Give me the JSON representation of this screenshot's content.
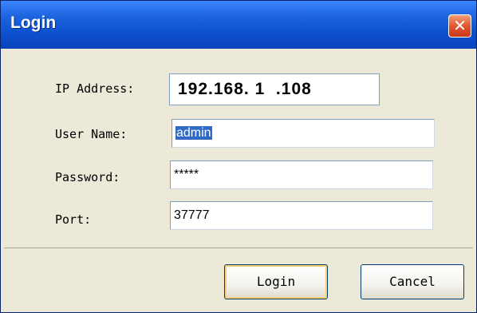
{
  "window": {
    "title": "Login",
    "close_symbol": "✕"
  },
  "form": {
    "ip_label": "IP Address:",
    "ip_value": "192.168. 1  .108",
    "user_label": "User Name:",
    "user_value": "admin",
    "password_label": "Password:",
    "password_value": "*****",
    "port_label": "Port:",
    "port_value": "37777"
  },
  "buttons": {
    "login_label": "Login",
    "cancel_label": "Cancel"
  },
  "colors": {
    "titlebar": "#0b4fcf",
    "dialog_background": "#ece9d8",
    "selection": "#316ac5",
    "close_button": "#e0522c"
  },
  "icons": {
    "close": "close-icon"
  }
}
